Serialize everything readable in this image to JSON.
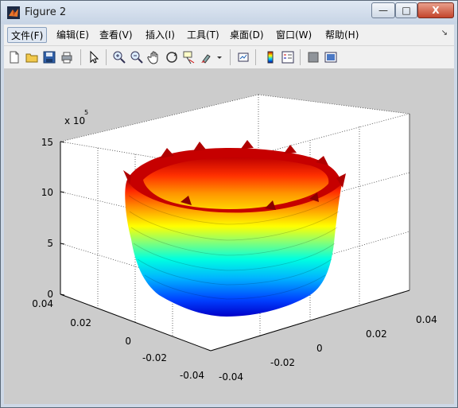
{
  "window": {
    "title": "Figure 2",
    "controls": {
      "minimize": "—",
      "maximize": "□",
      "close": "X"
    }
  },
  "menu": {
    "items": [
      "文件(F)",
      "编辑(E)",
      "查看(V)",
      "插入(I)",
      "工具(T)",
      "桌面(D)",
      "窗口(W)",
      "帮助(H)"
    ],
    "overflow_arrow": "↘"
  },
  "toolbar": {
    "icons": [
      "new-figure-icon",
      "open-file-icon",
      "save-icon",
      "print-icon",
      "pointer-icon",
      "zoom-in-icon",
      "zoom-out-icon",
      "pan-icon",
      "rotate-3d-icon",
      "data-cursor-icon",
      "brush-icon",
      "brush-dropdown-icon",
      "link-plot-icon",
      "colorbar-icon",
      "legend-icon",
      "hide-plot-tools-icon",
      "show-plot-tools-icon"
    ]
  },
  "chart_data": {
    "type": "surface",
    "title": "",
    "z_multiplier": "x 10",
    "z_exponent": "5",
    "z_ticks": [
      "0",
      "5",
      "10",
      "15"
    ],
    "x_ticks": [
      "-0.04",
      "-0.02",
      "0",
      "0.02",
      "0.04"
    ],
    "y_ticks": [
      "-0.04",
      "-0.02",
      "0",
      "0.02",
      "0.04"
    ],
    "xlim": [
      -0.04,
      0.04
    ],
    "ylim": [
      -0.04,
      0.04
    ],
    "zlim": [
      0,
      1500000
    ],
    "grid": true,
    "colormap": "jet",
    "description_of_shape": "ring-shaped wavy cylindrical surface with radius ~0.03, height up to ~1.4e6"
  }
}
